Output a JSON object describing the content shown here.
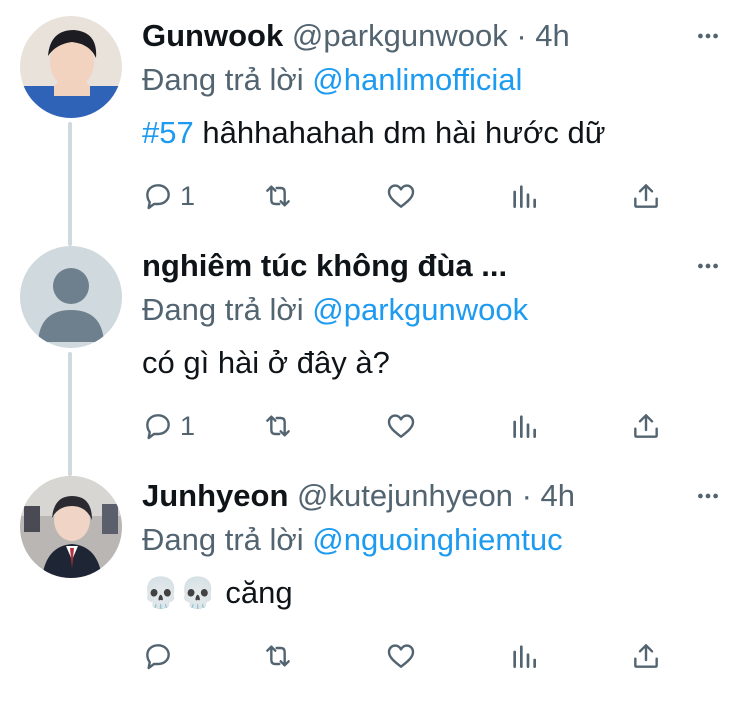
{
  "tweets": [
    {
      "name": "Gunwook",
      "handle": "@parkgunwook",
      "dot": "·",
      "time": "4h",
      "replying_prefix": "Đang trả lời",
      "replying_to": "@hanlimofficial",
      "hashtag": "#57",
      "text": "hâhhahahah dm hài hước dữ",
      "reply_count": "1",
      "retweet_count": "",
      "like_count": ""
    },
    {
      "name": "nghiêm túc không đùa ...",
      "handle": "",
      "dot": "",
      "time": "",
      "replying_prefix": "Đang trả lời",
      "replying_to": "@parkgunwook",
      "hashtag": "",
      "text": "có gì hài ở đây à?",
      "reply_count": "1",
      "retweet_count": "",
      "like_count": ""
    },
    {
      "name": "Junhyeon",
      "handle": "@kutejunhyeon",
      "dot": "·",
      "time": "4h",
      "replying_prefix": "Đang trả lời",
      "replying_to": "@nguoinghiemtuc",
      "emoji": "💀💀",
      "text": "căng",
      "reply_count": "",
      "retweet_count": "",
      "like_count": ""
    }
  ],
  "icons": {
    "more": "more-horizontal-icon",
    "reply": "reply-bubble-icon",
    "retweet": "retweet-icon",
    "like": "heart-icon",
    "views": "analytics-icon",
    "share": "share-icon"
  },
  "colors": {
    "link": "#1d9bf0",
    "secondary": "#536471",
    "thread_line": "#cfd9de"
  }
}
